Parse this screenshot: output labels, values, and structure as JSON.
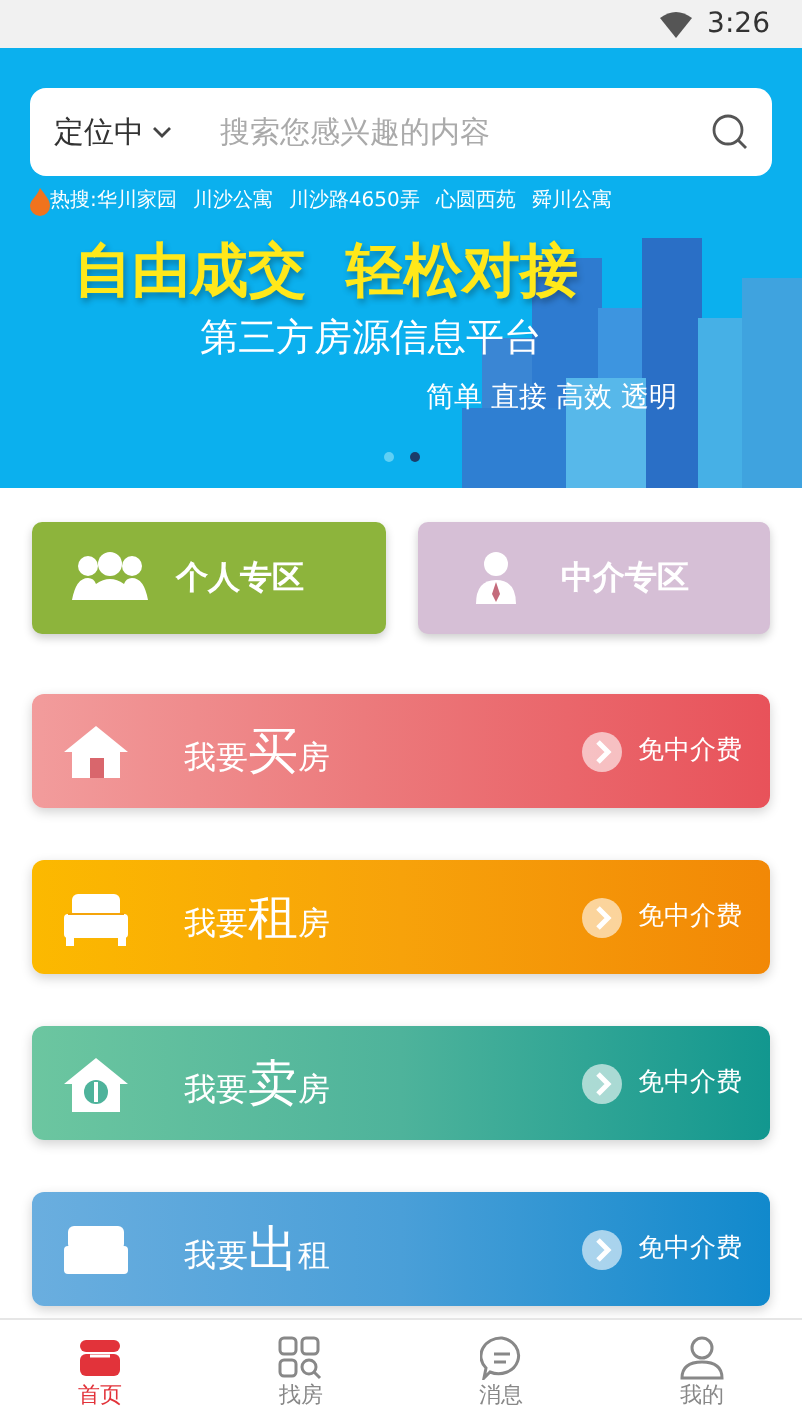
{
  "status_bar": {
    "time": "3:26"
  },
  "search": {
    "location": "定位中",
    "placeholder": "搜索您感兴趣的内容"
  },
  "hot_search": {
    "label": "热搜:",
    "terms": [
      "华川家园",
      "川沙公寓",
      "川沙路4650弄",
      "心圆西苑",
      "舜川公寓"
    ]
  },
  "banner": {
    "headline": "自由成交  轻松对接",
    "subtitle": "第三方房源信息平台",
    "tagline": "简单 直接 高效 透明",
    "dots": [
      {
        "selected": false
      },
      {
        "selected": true
      }
    ]
  },
  "zones": [
    {
      "kind": "group",
      "label": "个人专区",
      "color": "#8db43c"
    },
    {
      "kind": "agent",
      "label": "中介专区",
      "color": "#d6bfd6"
    }
  ],
  "services": [
    {
      "kind": "buy",
      "before": "我要",
      "key": "买",
      "after": "房",
      "note": "免中介费"
    },
    {
      "kind": "rent",
      "before": "我要",
      "key": "租",
      "after": "房",
      "note": "免中介费"
    },
    {
      "kind": "sell",
      "before": "我要",
      "key": "卖",
      "after": "房",
      "note": "免中介费"
    },
    {
      "kind": "let",
      "before": "我要",
      "key": "出",
      "after": "租",
      "note": "免中介费"
    }
  ],
  "tab_bar": [
    {
      "kind": "home",
      "label": "首页",
      "selected": true
    },
    {
      "kind": "find",
      "label": "找房",
      "selected": false
    },
    {
      "kind": "message",
      "label": "消息",
      "selected": false
    },
    {
      "kind": "me",
      "label": "我的",
      "selected": false
    }
  ]
}
